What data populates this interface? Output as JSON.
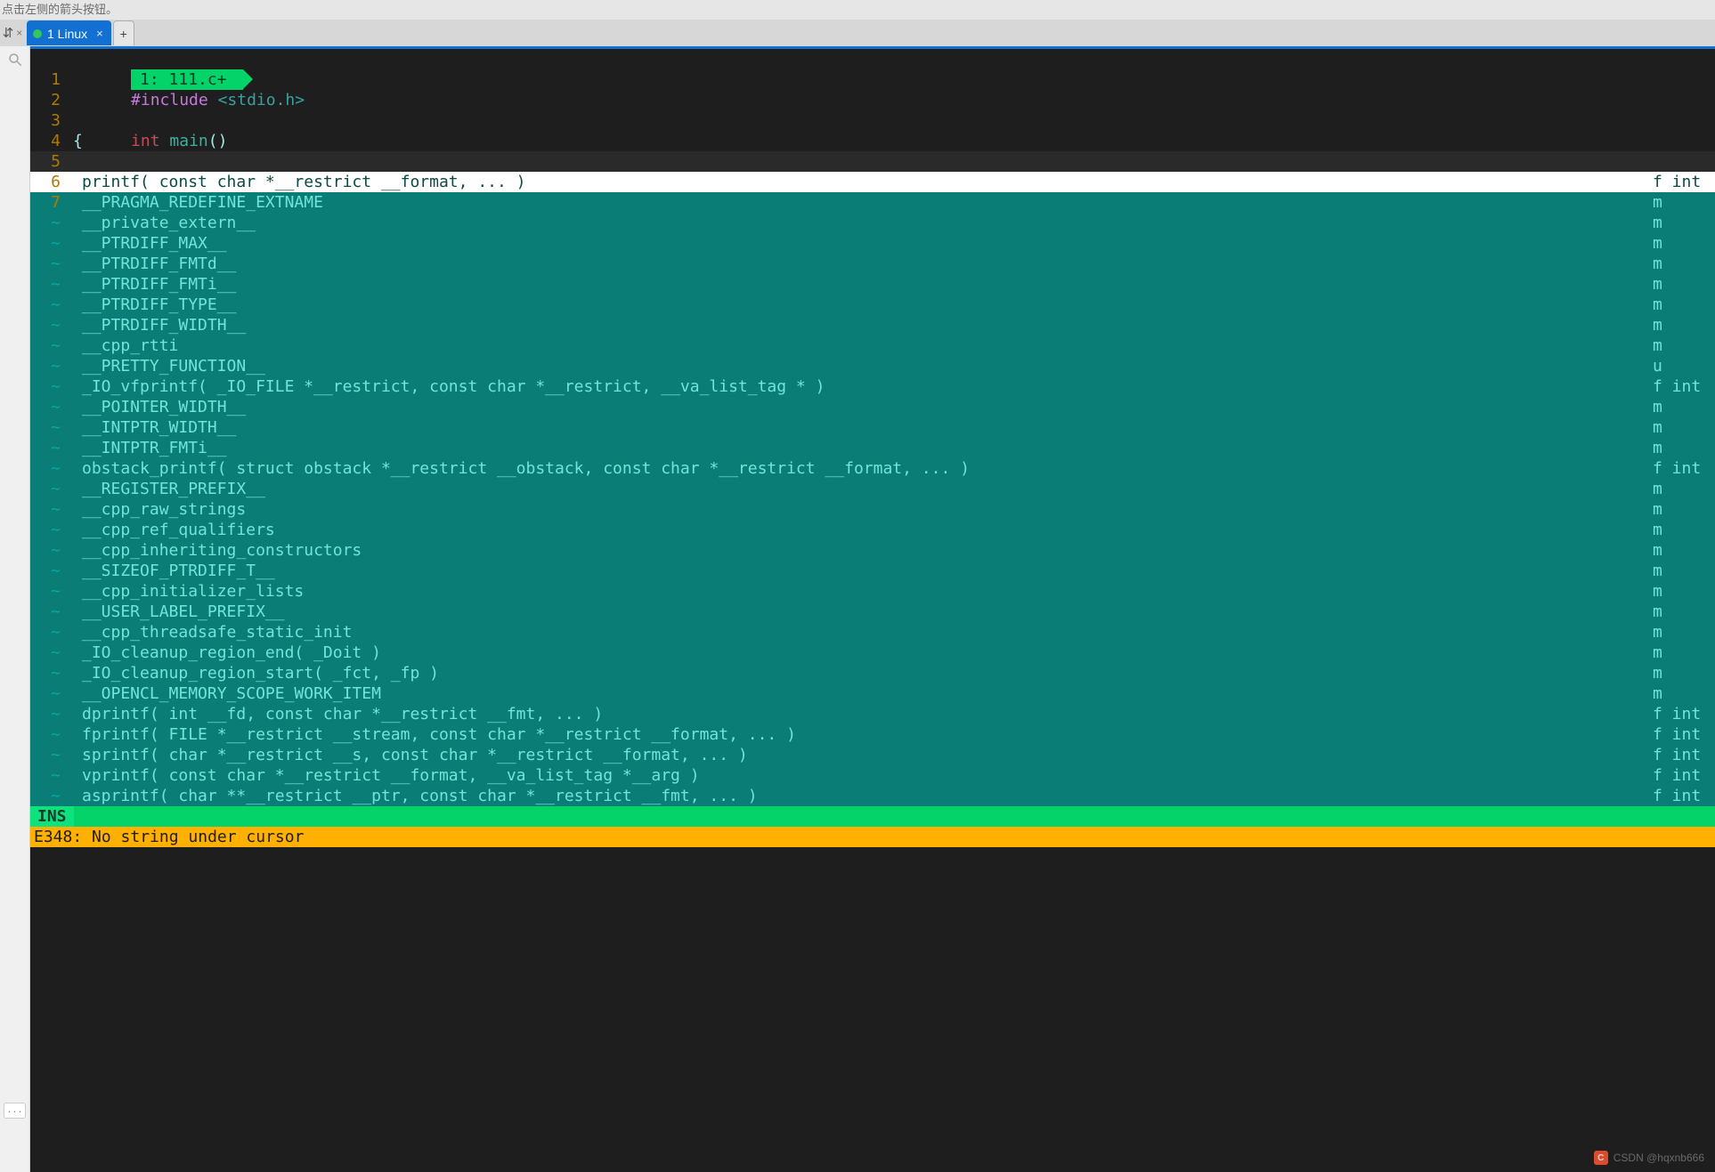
{
  "hint_text": "点击左侧的箭头按钮。",
  "outer_tab_stub_glyph": "⇵",
  "outer_tab": {
    "label": "1 Linux"
  },
  "left_gutter": {
    "search_title": "search",
    "ellipsis": "..."
  },
  "file_tab": "1: 111.c+",
  "code": {
    "include_kw": "#include",
    "include_hdr": "<stdio.h>",
    "int_kw": "int",
    "main_fn": "main",
    "main_parens": "()",
    "brace_open": "{",
    "printf_call": "printf",
    "line_numbers": [
      "1",
      "2",
      "3",
      "4",
      "5",
      "6",
      "7"
    ]
  },
  "completions_first_gutters": [
    "6",
    "7"
  ],
  "completions_tilde": "~",
  "completions": [
    {
      "label": "printf( const char *__restrict __format, ... )",
      "kind": "f int",
      "sel": true
    },
    {
      "label": "__PRAGMA_REDEFINE_EXTNAME",
      "kind": "m"
    },
    {
      "label": "__private_extern__",
      "kind": "m"
    },
    {
      "label": "__PTRDIFF_MAX__",
      "kind": "m"
    },
    {
      "label": "__PTRDIFF_FMTd__",
      "kind": "m"
    },
    {
      "label": "__PTRDIFF_FMTi__",
      "kind": "m"
    },
    {
      "label": "__PTRDIFF_TYPE__",
      "kind": "m"
    },
    {
      "label": "__PTRDIFF_WIDTH__",
      "kind": "m"
    },
    {
      "label": "__cpp_rtti",
      "kind": "m"
    },
    {
      "label": "__PRETTY_FUNCTION__",
      "kind": "u"
    },
    {
      "label": "_IO_vfprintf( _IO_FILE *__restrict, const char *__restrict, __va_list_tag * )",
      "kind": "f int"
    },
    {
      "label": "__POINTER_WIDTH__",
      "kind": "m"
    },
    {
      "label": "__INTPTR_WIDTH__",
      "kind": "m"
    },
    {
      "label": "__INTPTR_FMTi__",
      "kind": "m"
    },
    {
      "label": "obstack_printf( struct obstack *__restrict __obstack, const char *__restrict __format, ... )",
      "kind": "f int"
    },
    {
      "label": "__REGISTER_PREFIX__",
      "kind": "m"
    },
    {
      "label": "__cpp_raw_strings",
      "kind": "m"
    },
    {
      "label": "__cpp_ref_qualifiers",
      "kind": "m"
    },
    {
      "label": "__cpp_inheriting_constructors",
      "kind": "m"
    },
    {
      "label": "__SIZEOF_PTRDIFF_T__",
      "kind": "m"
    },
    {
      "label": "__cpp_initializer_lists",
      "kind": "m"
    },
    {
      "label": "__USER_LABEL_PREFIX__",
      "kind": "m"
    },
    {
      "label": "__cpp_threadsafe_static_init",
      "kind": "m"
    },
    {
      "label": "_IO_cleanup_region_end( _Doit )",
      "kind": "m"
    },
    {
      "label": "_IO_cleanup_region_start( _fct, _fp )",
      "kind": "m"
    },
    {
      "label": "__OPENCL_MEMORY_SCOPE_WORK_ITEM",
      "kind": "m"
    },
    {
      "label": "dprintf( int __fd, const char *__restrict __fmt, ... )",
      "kind": "f int"
    },
    {
      "label": "fprintf( FILE *__restrict __stream, const char *__restrict __format, ... )",
      "kind": "f int"
    },
    {
      "label": "sprintf( char *__restrict __s, const char *__restrict __format, ... )",
      "kind": "f int"
    },
    {
      "label": "vprintf( const char *__restrict __format, __va_list_tag *__arg )",
      "kind": "f int"
    },
    {
      "label": "asprintf( char **__restrict __ptr, const char *__restrict __fmt, ... )",
      "kind": "f int"
    }
  ],
  "status": {
    "mode": "INS",
    "rest_placeholder": ""
  },
  "cmdline": "E348: No string under cursor",
  "watermark": {
    "logo_text": "C",
    "handle": "CSDN @hqxnb666"
  }
}
